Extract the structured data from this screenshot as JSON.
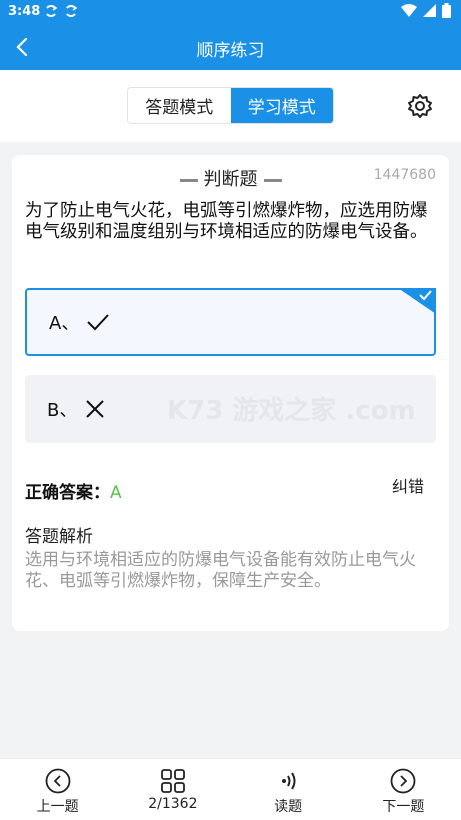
{
  "status": {
    "time": "3:48"
  },
  "header": {
    "title": "顺序练习"
  },
  "modes": [
    {
      "label": "答题模式"
    },
    {
      "label": "学习模式"
    }
  ],
  "question": {
    "type": "判断题",
    "id": "1447680",
    "text": "为了防止电气火花，电弧等引燃爆炸物，应选用防爆电气级别和温度组别与环境相适应的防爆电气设备。",
    "options": [
      {
        "label": "A、",
        "symbol": "checkmark-icon"
      },
      {
        "label": "B、",
        "symbol": "cross-icon"
      }
    ]
  },
  "answer": {
    "label": "正确答案",
    "separator": "：",
    "value": "A",
    "report": "纠错"
  },
  "explanation": {
    "title": "答题解析",
    "text": "选用与环境相适应的防爆电气设备能有效防止电气火花、电弧等引燃爆炸物，保障生产安全。"
  },
  "watermark": "K73 游戏之家 .com",
  "footer": {
    "prev": "上一题",
    "progress": "2/1362",
    "read": "读题",
    "next": "下一题"
  },
  "colors": {
    "accent": "#1a90e6",
    "correct": "#55c34c"
  }
}
